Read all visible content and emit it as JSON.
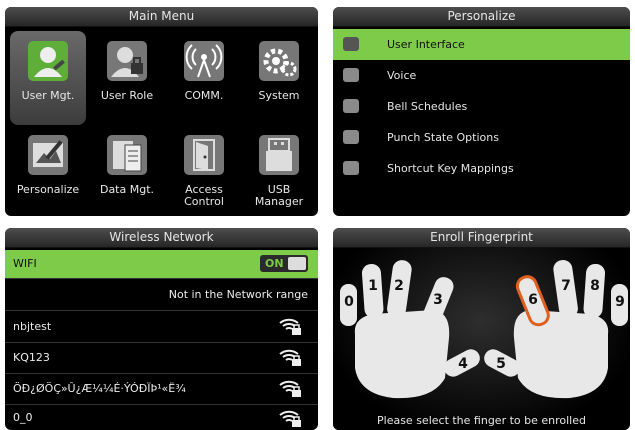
{
  "main_menu": {
    "title": "Main Menu",
    "items": [
      {
        "label": "User Mgt.",
        "label2": "",
        "icon": "user-mgt-icon",
        "selected": true
      },
      {
        "label": "User Role",
        "label2": "",
        "icon": "user-role-icon"
      },
      {
        "label": "COMM.",
        "label2": "",
        "icon": "comm-icon"
      },
      {
        "label": "System",
        "label2": "",
        "icon": "system-gear-icon"
      },
      {
        "label": "Personalize",
        "label2": "",
        "icon": "personalize-icon"
      },
      {
        "label": "Data Mgt.",
        "label2": "",
        "icon": "data-mgt-icon"
      },
      {
        "label": "Access",
        "label2": "Control",
        "icon": "access-control-icon"
      },
      {
        "label": "USB",
        "label2": "Manager",
        "icon": "usb-manager-icon"
      }
    ]
  },
  "personalize": {
    "title": "Personalize",
    "items": [
      {
        "label": "User Interface",
        "selected": true
      },
      {
        "label": "Voice"
      },
      {
        "label": "Bell Schedules"
      },
      {
        "label": "Punch State Options"
      },
      {
        "label": "Shortcut Key Mappings"
      }
    ]
  },
  "wireless": {
    "title": "Wireless Network",
    "wifi_label": "WIFI",
    "wifi_toggle": "ON",
    "status": "Not in the Network range",
    "networks": [
      "nbjtest",
      "KQ123",
      "ÖÐ¿ØÖÇ»Û¿Æ¼¼É·ÝÓÐÏÞ¹«Ë¾",
      "0_0"
    ]
  },
  "fingerprint": {
    "title": "Enroll Fingerprint",
    "fingers": [
      "0",
      "1",
      "2",
      "3",
      "4",
      "5",
      "6",
      "7",
      "8",
      "9"
    ],
    "highlighted": "6",
    "hint": "Please select the finger to be enrolled"
  },
  "colors": {
    "accent": "#7ecb4a",
    "highlight_finger": "#e06020"
  }
}
